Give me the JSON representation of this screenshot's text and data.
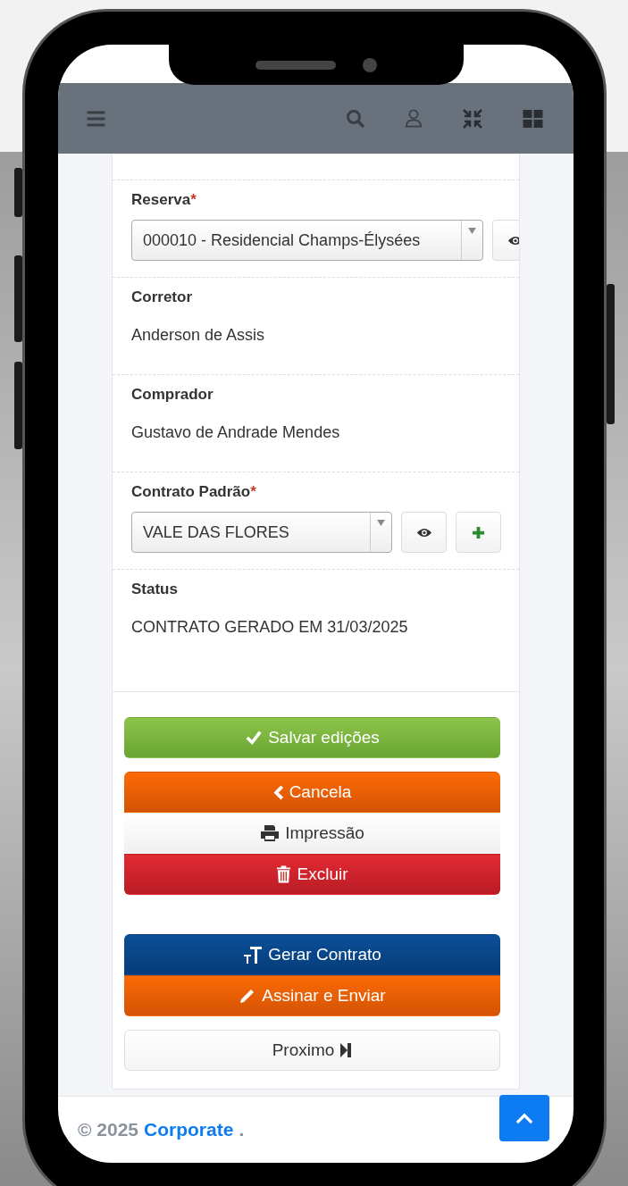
{
  "fields": [
    {
      "kind": "select",
      "label": "Reserva",
      "required_mark": "*",
      "value": "000010 - Residencial Champs-Élysées",
      "actions": [
        {
          "kind": "view"
        }
      ]
    },
    {
      "kind": "text",
      "label": "Corretor",
      "value": "Anderson de Assis"
    },
    {
      "kind": "text",
      "label": "Comprador",
      "value": "Gustavo de Andrade Mendes"
    },
    {
      "kind": "select",
      "label": "Contrato Padrão",
      "required_mark": "*",
      "value": "VALE DAS FLORES",
      "actions": [
        {
          "kind": "view"
        },
        {
          "kind": "add"
        }
      ]
    },
    {
      "kind": "text",
      "label": "Status",
      "value": "CONTRATO GERADO EM 31/03/2025"
    }
  ],
  "button_groups": [
    [
      {
        "kind": "success",
        "label": "Salvar edições"
      }
    ],
    [
      {
        "kind": "warning",
        "label": "Cancela"
      },
      {
        "kind": "light",
        "label": "Impressão"
      },
      {
        "kind": "danger",
        "label": "Excluir"
      }
    ],
    [
      {
        "kind": "primary",
        "label": "Gerar Contrato"
      },
      {
        "kind": "warning",
        "label": "Assinar e Enviar"
      }
    ],
    [
      {
        "kind": "default",
        "label": "Proximo"
      }
    ]
  ],
  "footer": {
    "copyright": "© 2025",
    "link": "Corporate",
    "suffix": "."
  }
}
